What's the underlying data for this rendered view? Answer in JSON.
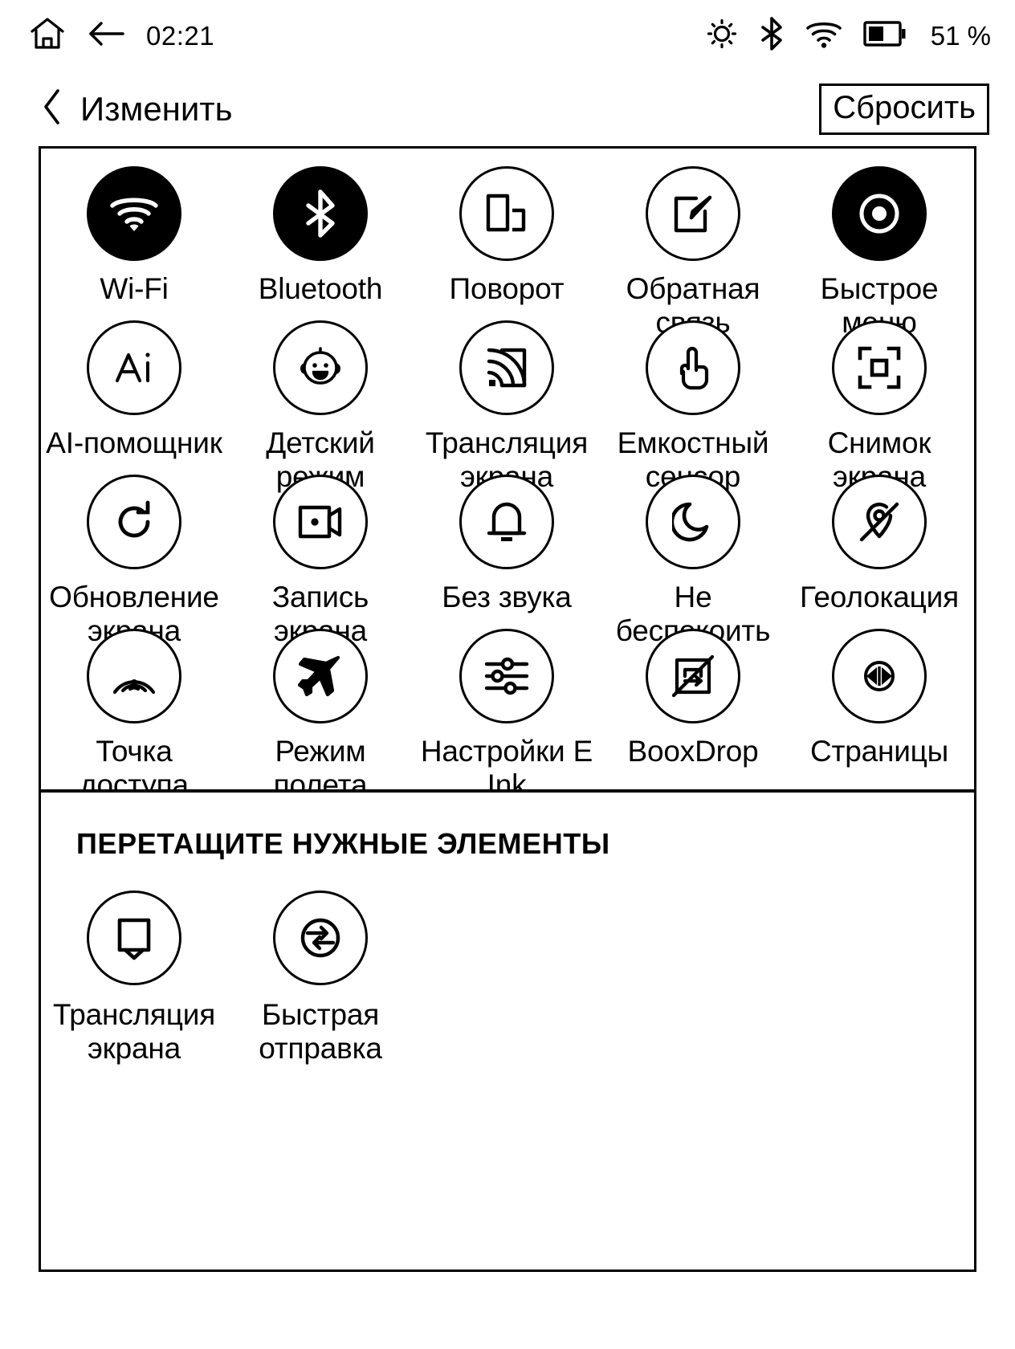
{
  "statusbar": {
    "home_icon": "home-icon",
    "back_icon": "back-arrow-icon",
    "time": "02:21",
    "brightness_icon": "brightness-icon",
    "bluetooth_icon": "bluetooth-icon",
    "wifi_icon": "wifi-icon",
    "battery_icon": "battery-icon",
    "battery_percent": "51 %"
  },
  "titlebar": {
    "back_icon": "chevron-left-icon",
    "title": "Изменить",
    "reset_label": "Сбросить"
  },
  "toggles": [
    {
      "label": "Wi-Fi",
      "icon": "wifi-icon",
      "active": true
    },
    {
      "label": "Bluetooth",
      "icon": "bluetooth-icon",
      "active": true
    },
    {
      "label": "Поворот",
      "icon": "rotation-icon",
      "active": false
    },
    {
      "label": "Обратная связь",
      "icon": "feedback-icon",
      "active": false
    },
    {
      "label": "Быстрое меню",
      "icon": "quick-menu-icon",
      "active": true
    },
    {
      "label": "AI-помощник",
      "icon": "ai-assistant-icon",
      "active": false
    },
    {
      "label": "Детский режим",
      "icon": "kid-mode-icon",
      "active": false
    },
    {
      "label": "Трансляция экрана",
      "icon": "screencast-icon",
      "active": false
    },
    {
      "label": "Емкостный сенсор",
      "icon": "capacitive-touch-icon",
      "active": false
    },
    {
      "label": "Снимок экрана",
      "icon": "screenshot-icon",
      "active": false
    },
    {
      "label": "Обновление экрана",
      "icon": "refresh-icon",
      "active": false
    },
    {
      "label": "Запись экрана",
      "icon": "screen-record-icon",
      "active": false
    },
    {
      "label": "Без звука",
      "icon": "mute-bell-icon",
      "active": false
    },
    {
      "label": "Не беспокоить",
      "icon": "do-not-disturb-icon",
      "active": false
    },
    {
      "label": "Геолокация",
      "icon": "location-off-icon",
      "active": false
    },
    {
      "label": "Точка доступа",
      "icon": "hotspot-icon",
      "active": false
    },
    {
      "label": "Режим полета",
      "icon": "airplane-icon",
      "active": false
    },
    {
      "label": "Настройки E Ink",
      "icon": "eink-settings-icon",
      "active": false
    },
    {
      "label": "BooxDrop",
      "icon": "booxdrop-icon",
      "active": false
    },
    {
      "label": "Страницы",
      "icon": "pages-icon",
      "active": false
    }
  ],
  "dropzone": {
    "title": "ПЕРЕТАЩИТЕ НУЖНЫЕ ЭЛЕМЕНТЫ",
    "items": [
      {
        "label": "Трансляция экрана",
        "icon": "bookmark-icon"
      },
      {
        "label": "Быстрая отправка",
        "icon": "quick-send-icon"
      }
    ]
  },
  "colors": {
    "foreground": "#000000",
    "background": "#ffffff",
    "active_fill": "#000000"
  }
}
